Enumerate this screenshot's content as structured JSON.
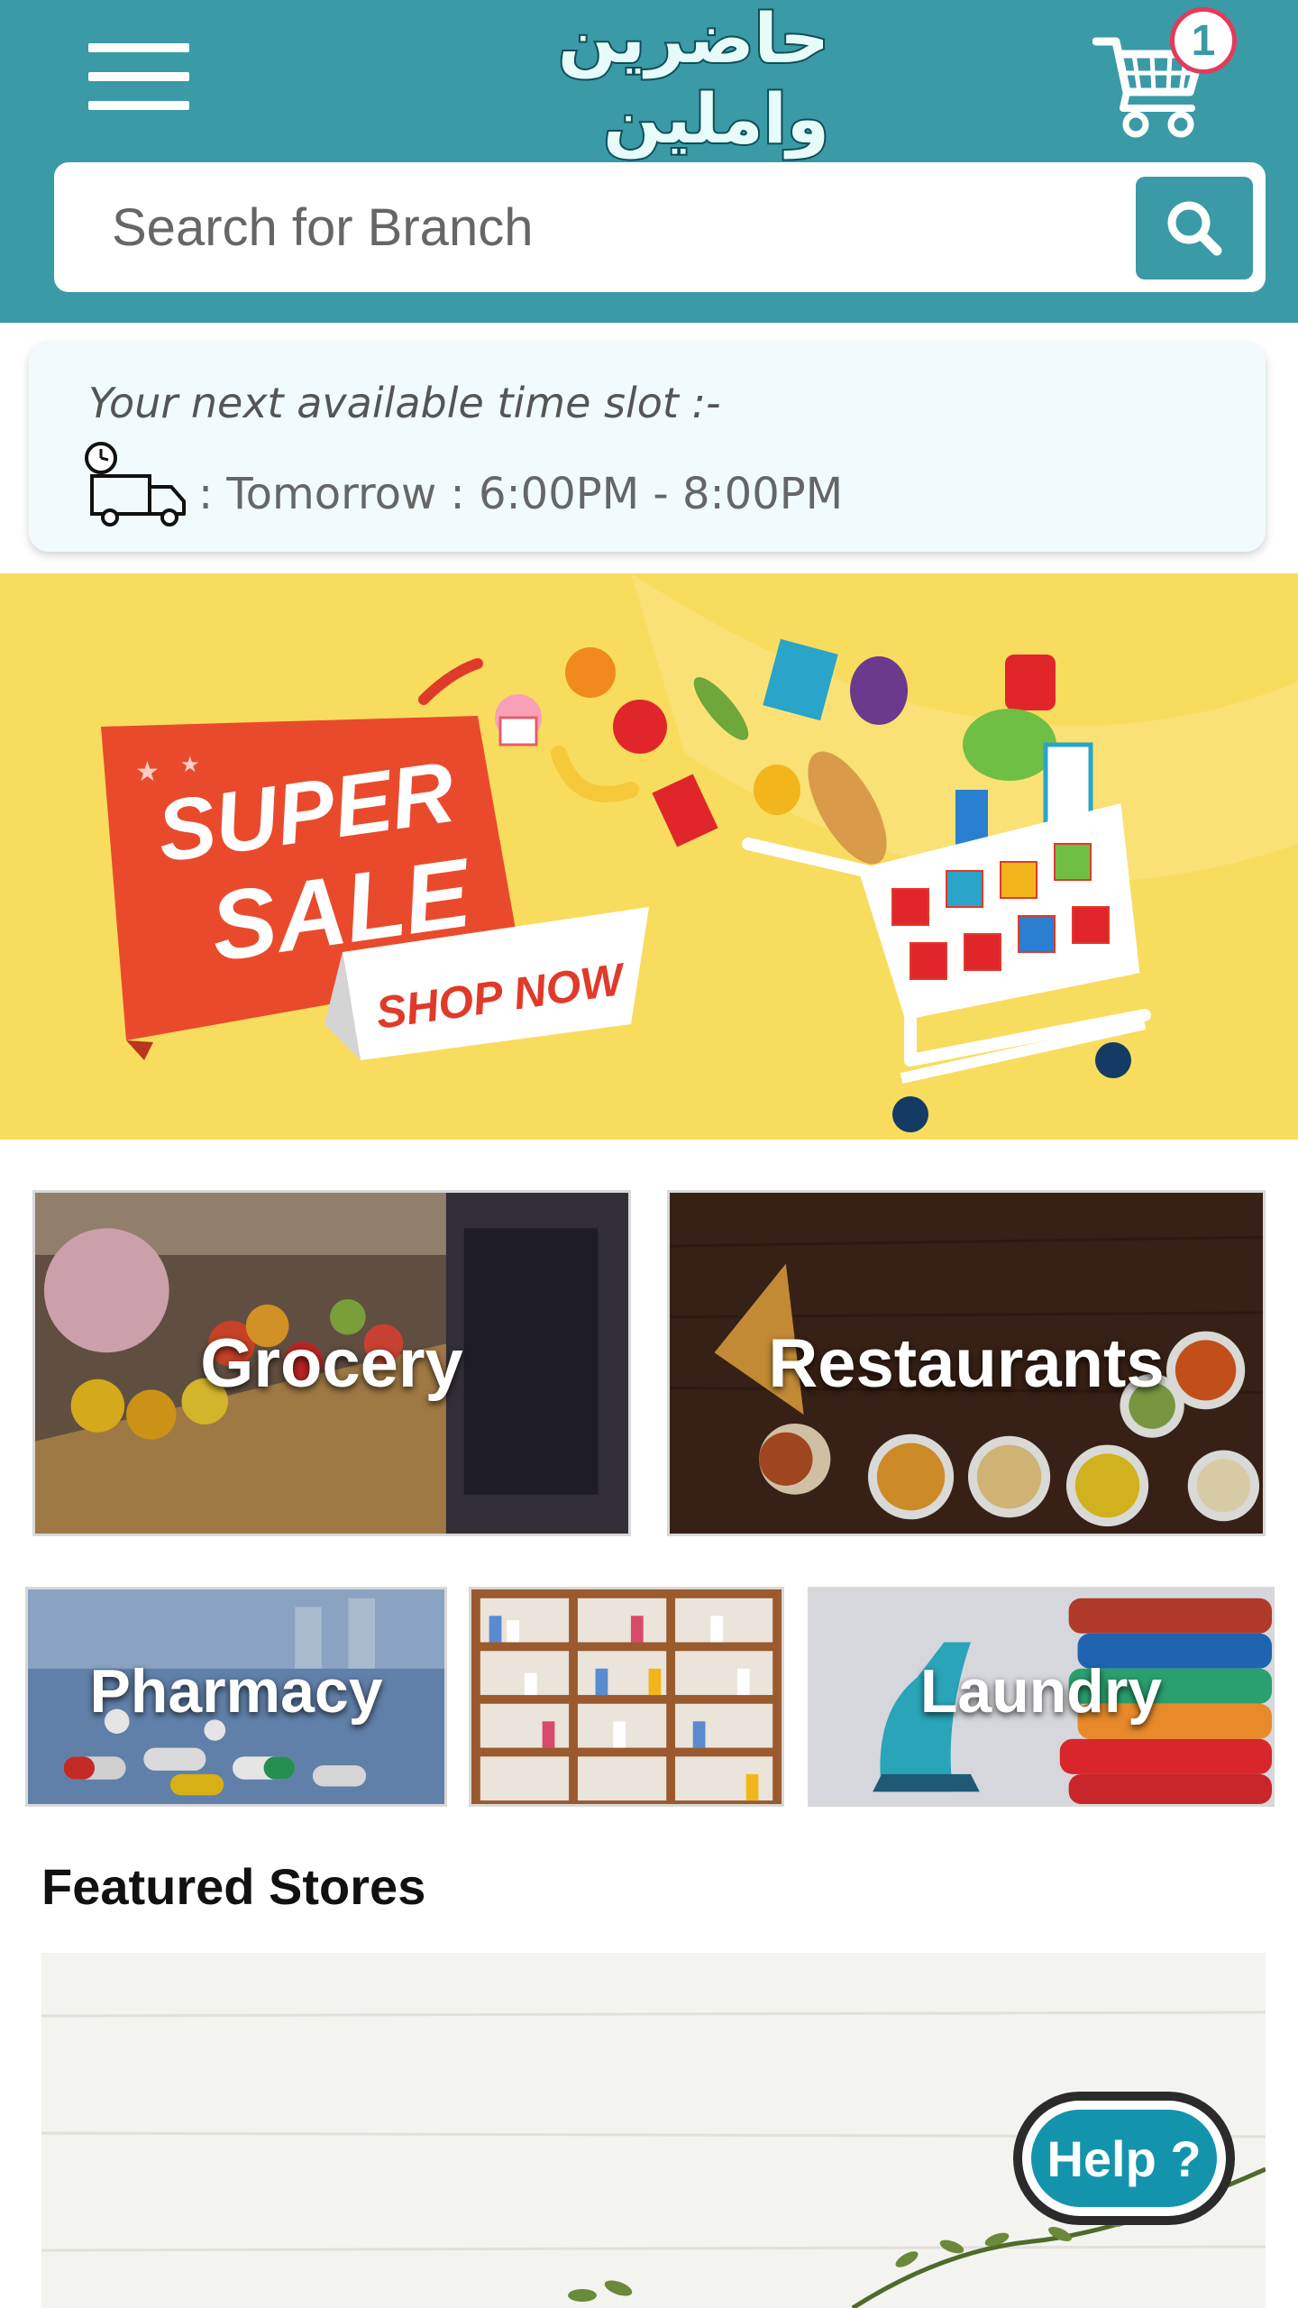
{
  "header": {
    "logo_text": "حاضرين واملين",
    "cart_count": "1",
    "search_placeholder": "Search for Branch"
  },
  "time_slot": {
    "title": "Your next available time slot :-",
    "value": ": Tomorrow : 6:00PM - 8:00PM"
  },
  "banner": {
    "line1": "SUPER",
    "line2": "SALE",
    "cta": "SHOP NOW"
  },
  "categories": {
    "grocery": "Grocery",
    "restaurants": "Restaurants",
    "pharmacy": "Pharmacy",
    "laundry": "Laundry"
  },
  "featured": {
    "title": "Featured Stores"
  },
  "help": {
    "label": "Help ?"
  },
  "colors": {
    "header_bg": "#3a9aa6",
    "banner_bg": "#f8dc5e",
    "badge_border": "#e43a5a",
    "help_bg": "#1494ac"
  },
  "icons": [
    "hamburger-icon",
    "cart-icon",
    "search-icon",
    "delivery-truck-clock-icon"
  ]
}
